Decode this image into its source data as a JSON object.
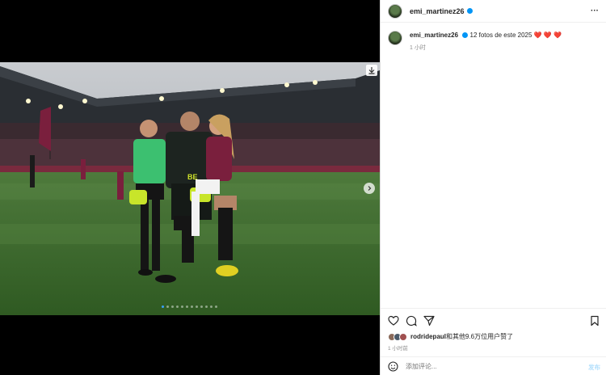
{
  "post": {
    "username": "emi_martinez26",
    "options_label": "···",
    "caption": {
      "username": "emi_martinez26",
      "text": "12 fotos de este 2025",
      "hearts": "❤️ ❤️ ❤️",
      "time": "1 小时"
    },
    "carousel": {
      "total": 12,
      "current": 1
    },
    "likes": {
      "username": "rodridepaul",
      "text": "和其他9.6万位用户赞了"
    },
    "time": "1 小时前",
    "comment": {
      "placeholder": "添加评论...",
      "post_label": "发布"
    }
  },
  "icons": [
    "download-icon",
    "chevron-right-icon",
    "heart-icon",
    "comment-icon",
    "share-icon",
    "bookmark-icon",
    "emoji-icon",
    "verified-icon"
  ],
  "colors": {
    "accent": "#0095f6",
    "heart": "#ed4956",
    "muted": "#8e8e8e"
  }
}
